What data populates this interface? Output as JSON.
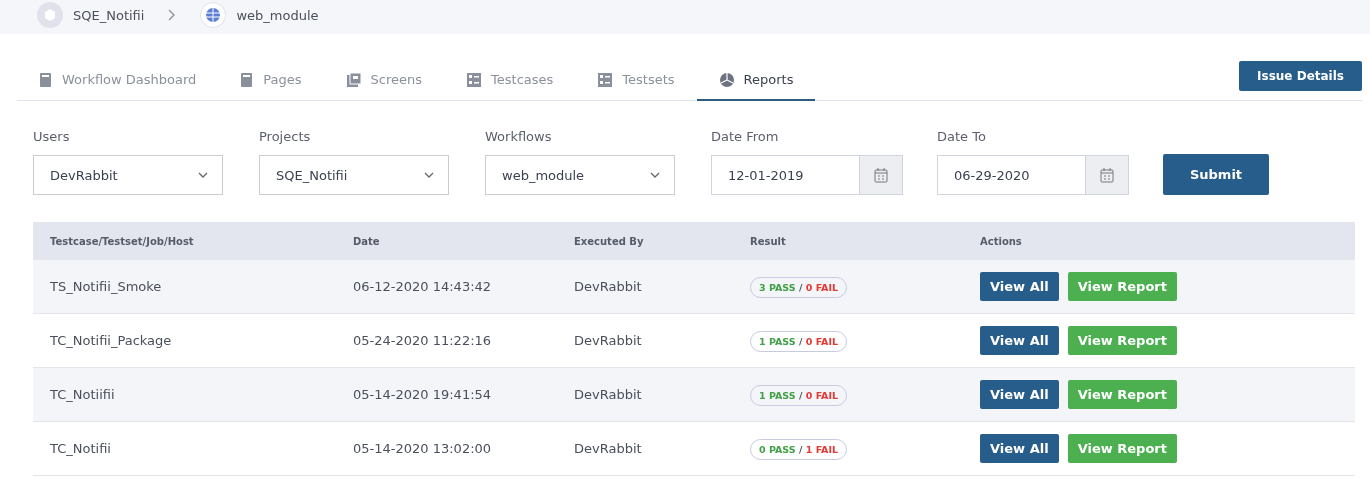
{
  "breadcrumb": [
    {
      "label": "SQE_Notifii",
      "kind": "box"
    },
    {
      "label": "web_module",
      "kind": "globe"
    }
  ],
  "tabs": [
    {
      "label": "Workflow Dashboard",
      "kind": "doc",
      "selected": false
    },
    {
      "label": "Pages",
      "kind": "doc",
      "selected": false
    },
    {
      "label": "Screens",
      "kind": "stack",
      "selected": false
    },
    {
      "label": "Testcases",
      "kind": "list",
      "selected": false
    },
    {
      "label": "Testsets",
      "kind": "list",
      "selected": false
    },
    {
      "label": "Reports",
      "kind": "pie",
      "selected": true
    }
  ],
  "issue_button": "Issue Details",
  "filters": [
    {
      "label": "Users",
      "kind": "select",
      "value": "DevRabbit"
    },
    {
      "label": "Projects",
      "kind": "select",
      "value": "SQE_Notifii"
    },
    {
      "label": "Workflows",
      "kind": "select",
      "value": "web_module"
    },
    {
      "label": "Date From",
      "kind": "date",
      "value": "12-01-2019"
    },
    {
      "label": "Date To",
      "kind": "date",
      "value": "06-29-2020"
    }
  ],
  "submit_button": "Submit",
  "table": {
    "columns": [
      "Testcase/Testset/Job/Host",
      "Date",
      "Executed By",
      "Result",
      "Actions"
    ],
    "rows": [
      {
        "name": "TS_Notifii_Smoke",
        "date": "06-12-2020 14:43:42",
        "executed_by": "DevRabbit",
        "pass": "3 PASS",
        "separator": "/",
        "fail": "0 FAIL",
        "actions": [
          "View All",
          "View Report"
        ]
      },
      {
        "name": "TC_Notifii_Package",
        "date": "05-24-2020 11:22:16",
        "executed_by": "DevRabbit",
        "pass": "1 PASS",
        "separator": "/",
        "fail": "0 FAIL",
        "actions": [
          "View All",
          "View Report"
        ]
      },
      {
        "name": "TC_Notiifii",
        "date": "05-14-2020 19:41:54",
        "executed_by": "DevRabbit",
        "pass": "1 PASS",
        "separator": "/",
        "fail": "0 FAIL",
        "actions": [
          "View All",
          "View Report"
        ]
      },
      {
        "name": "TC_Notifii",
        "date": "05-14-2020 13:02:00",
        "executed_by": "DevRabbit",
        "pass": "0 PASS",
        "separator": "/",
        "fail": "1 FAIL",
        "actions": [
          "View All",
          "View Report"
        ]
      }
    ]
  }
}
